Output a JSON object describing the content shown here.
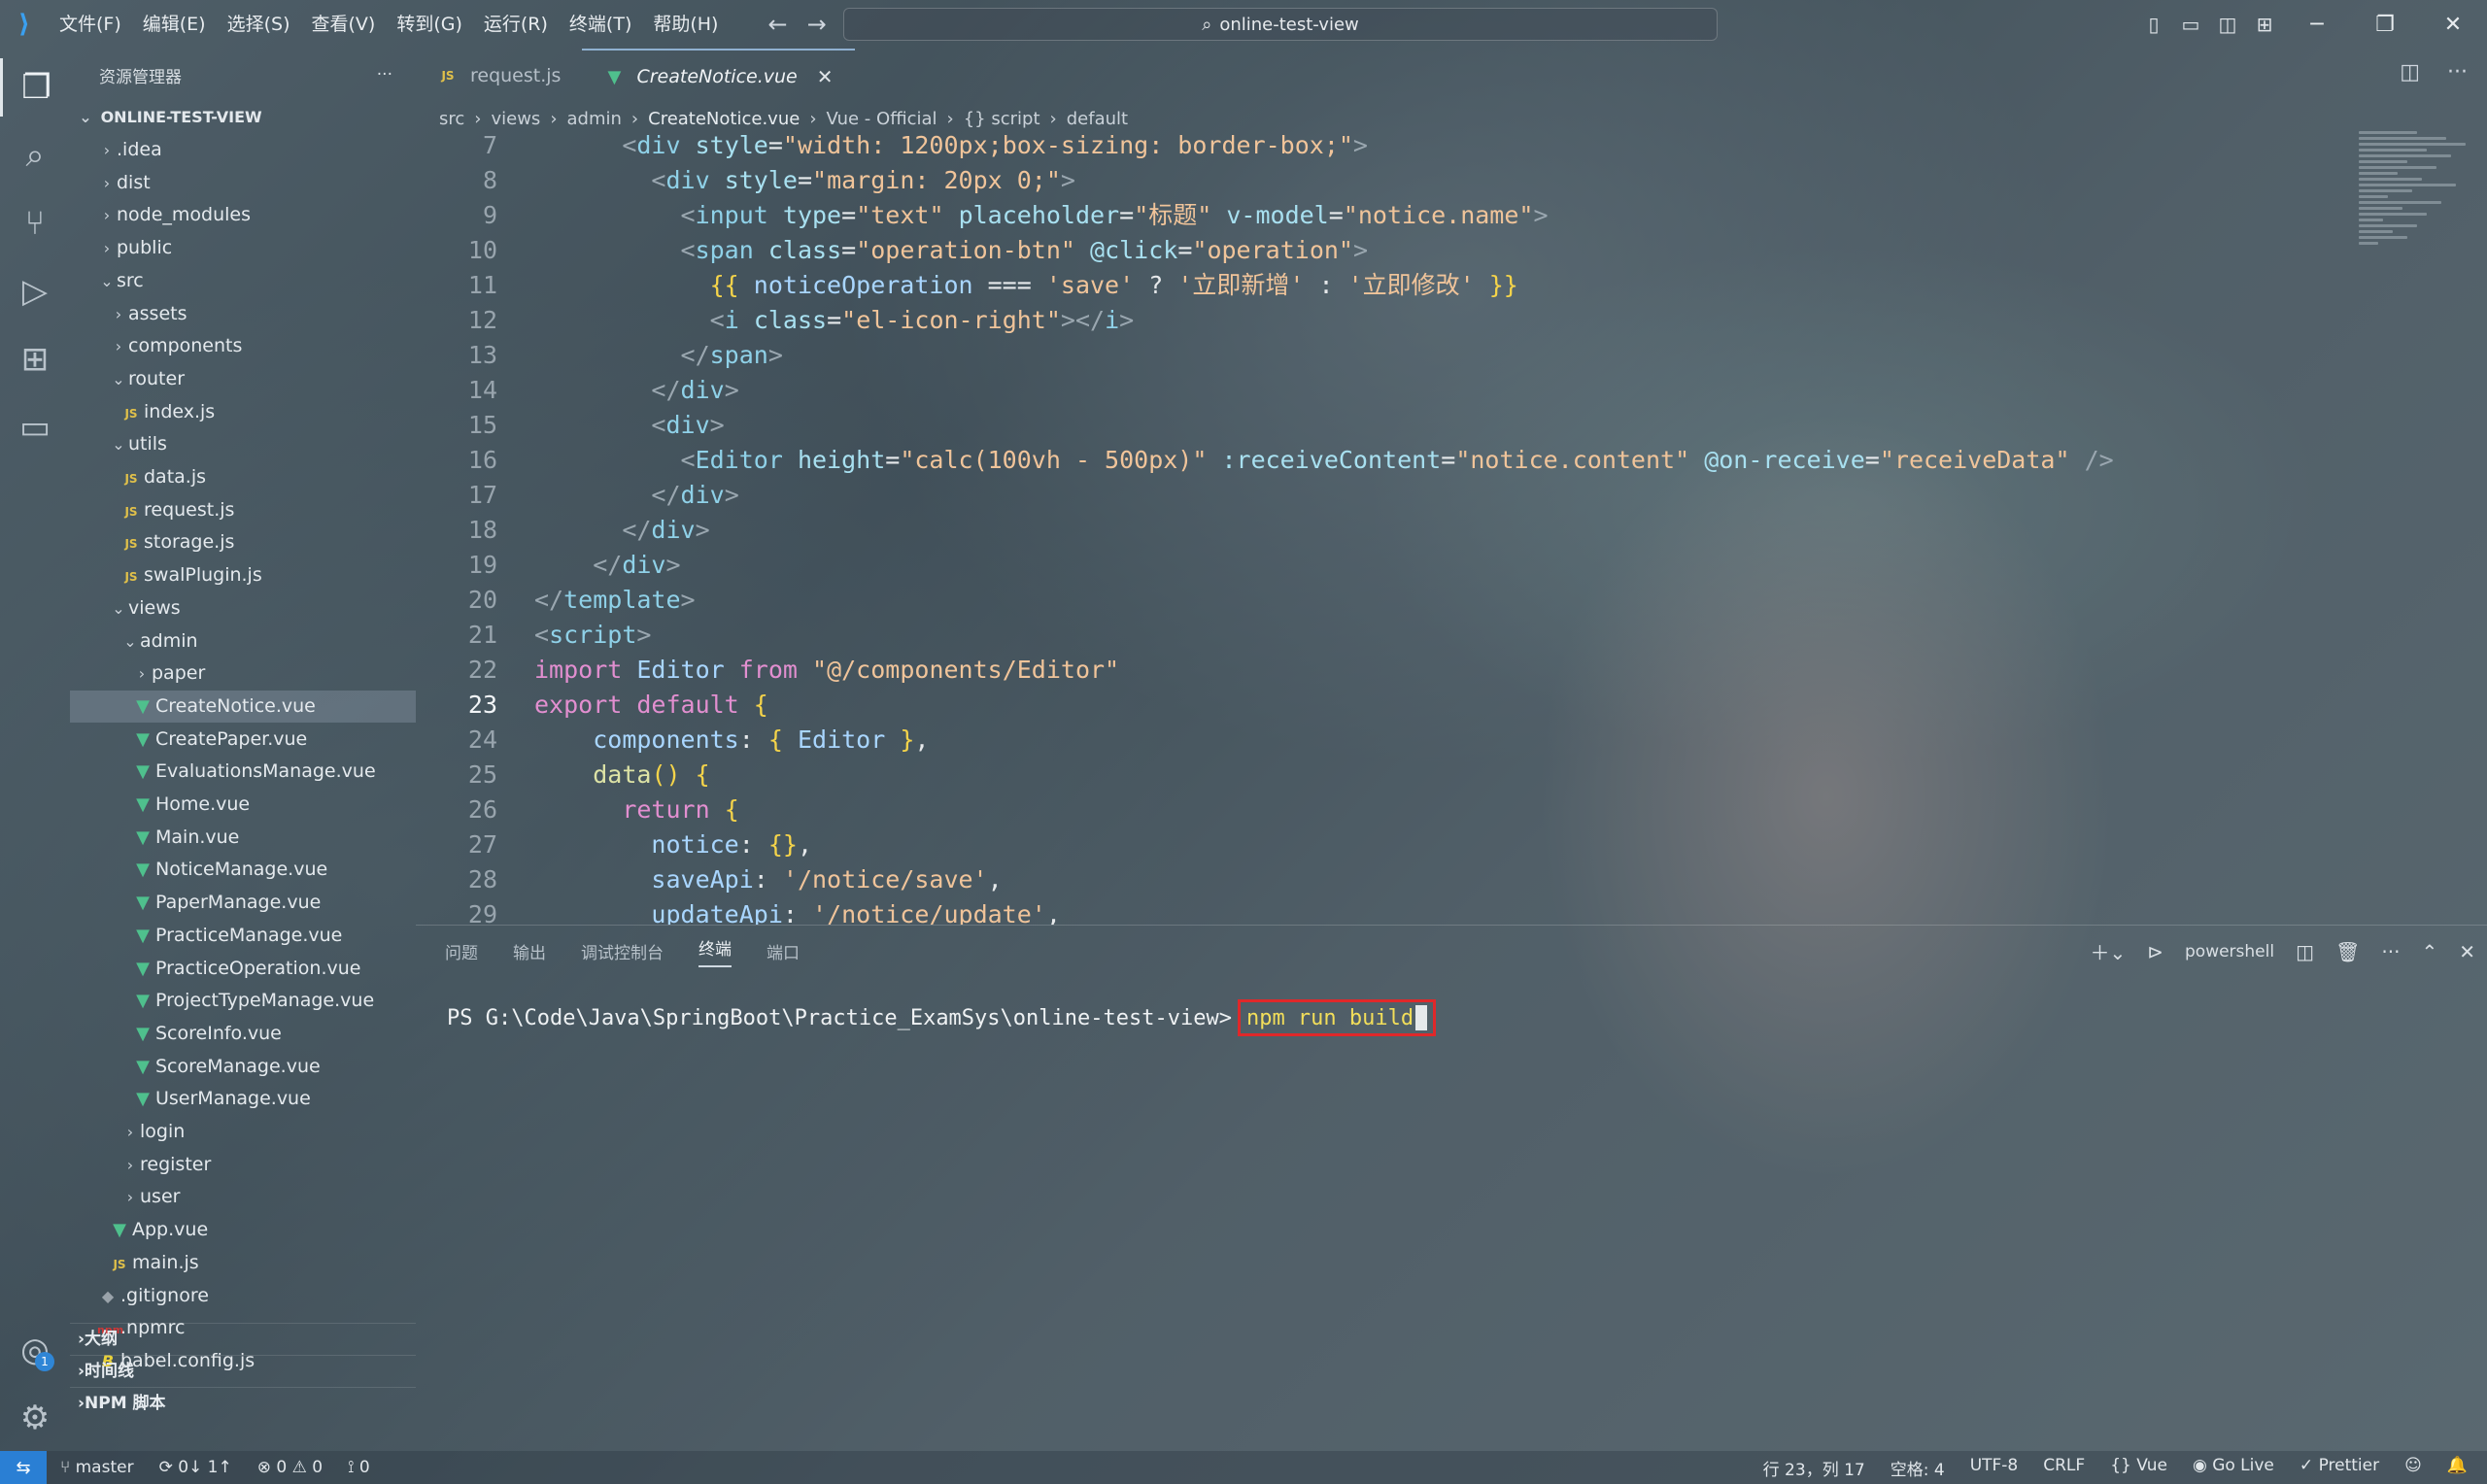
{
  "titlebar": {
    "menu": [
      "文件(F)",
      "编辑(E)",
      "选择(S)",
      "查看(V)",
      "转到(G)",
      "运行(R)",
      "终端(T)",
      "帮助(H)"
    ],
    "search_text": "online-test-view"
  },
  "sidebar": {
    "title": "资源管理器",
    "root": "ONLINE-TEST-VIEW",
    "items": [
      {
        "label": ".idea",
        "type": "folder",
        "depth": 0,
        "open": false
      },
      {
        "label": "dist",
        "type": "folder",
        "depth": 0,
        "open": false
      },
      {
        "label": "node_modules",
        "type": "folder",
        "depth": 0,
        "open": false
      },
      {
        "label": "public",
        "type": "folder",
        "depth": 0,
        "open": false
      },
      {
        "label": "src",
        "type": "folder",
        "depth": 0,
        "open": true
      },
      {
        "label": "assets",
        "type": "folder",
        "depth": 1,
        "open": false
      },
      {
        "label": "components",
        "type": "folder",
        "depth": 1,
        "open": false
      },
      {
        "label": "router",
        "type": "folder",
        "depth": 1,
        "open": true
      },
      {
        "label": "index.js",
        "type": "js",
        "depth": 2
      },
      {
        "label": "utils",
        "type": "folder",
        "depth": 1,
        "open": true
      },
      {
        "label": "data.js",
        "type": "js",
        "depth": 2
      },
      {
        "label": "request.js",
        "type": "js",
        "depth": 2
      },
      {
        "label": "storage.js",
        "type": "js",
        "depth": 2
      },
      {
        "label": "swalPlugin.js",
        "type": "js",
        "depth": 2
      },
      {
        "label": "views",
        "type": "folder",
        "depth": 1,
        "open": true
      },
      {
        "label": "admin",
        "type": "folder",
        "depth": 2,
        "open": true
      },
      {
        "label": "paper",
        "type": "folder",
        "depth": 3,
        "open": false
      },
      {
        "label": "CreateNotice.vue",
        "type": "vue",
        "depth": 3,
        "selected": true
      },
      {
        "label": "CreatePaper.vue",
        "type": "vue",
        "depth": 3
      },
      {
        "label": "EvaluationsManage.vue",
        "type": "vue",
        "depth": 3
      },
      {
        "label": "Home.vue",
        "type": "vue",
        "depth": 3
      },
      {
        "label": "Main.vue",
        "type": "vue",
        "depth": 3
      },
      {
        "label": "NoticeManage.vue",
        "type": "vue",
        "depth": 3
      },
      {
        "label": "PaperManage.vue",
        "type": "vue",
        "depth": 3
      },
      {
        "label": "PracticeManage.vue",
        "type": "vue",
        "depth": 3
      },
      {
        "label": "PracticeOperation.vue",
        "type": "vue",
        "depth": 3
      },
      {
        "label": "ProjectTypeManage.vue",
        "type": "vue",
        "depth": 3
      },
      {
        "label": "ScoreInfo.vue",
        "type": "vue",
        "depth": 3
      },
      {
        "label": "ScoreManage.vue",
        "type": "vue",
        "depth": 3
      },
      {
        "label": "UserManage.vue",
        "type": "vue",
        "depth": 3
      },
      {
        "label": "login",
        "type": "folder",
        "depth": 2,
        "open": false
      },
      {
        "label": "register",
        "type": "folder",
        "depth": 2,
        "open": false
      },
      {
        "label": "user",
        "type": "folder",
        "depth": 2,
        "open": false
      },
      {
        "label": "App.vue",
        "type": "vue",
        "depth": 1
      },
      {
        "label": "main.js",
        "type": "js",
        "depth": 1
      },
      {
        "label": ".gitignore",
        "type": "git",
        "depth": 0
      },
      {
        "label": ".npmrc",
        "type": "npm",
        "depth": 0
      },
      {
        "label": "babel.config.js",
        "type": "babel",
        "depth": 0
      }
    ],
    "sections": [
      "大纲",
      "时间线",
      "NPM 脚本"
    ]
  },
  "tabs": [
    {
      "label": "request.js",
      "icon": "JS",
      "active": false
    },
    {
      "label": "CreateNotice.vue",
      "icon": "vue",
      "active": true
    }
  ],
  "breadcrumb": [
    "src",
    "views",
    "admin",
    "CreateNotice.vue",
    "Vue - Official",
    "{} script",
    "default"
  ],
  "code": {
    "current_line": 23,
    "lines": [
      {
        "n": "7",
        "tokens": [
          [
            "ind",
            "      "
          ],
          [
            "t-punct",
            "<"
          ],
          [
            "t-tag",
            "div"
          ],
          [
            "txt",
            " "
          ],
          [
            "t-attr",
            "style"
          ],
          [
            "txt",
            "="
          ],
          [
            "t-str",
            "\"width: 1200px;box-sizing: border-box;\""
          ],
          [
            "t-punct",
            ">"
          ]
        ]
      },
      {
        "n": "8",
        "tokens": [
          [
            "ind",
            "        "
          ],
          [
            "t-punct",
            "<"
          ],
          [
            "t-tag",
            "div"
          ],
          [
            "txt",
            " "
          ],
          [
            "t-attr",
            "style"
          ],
          [
            "txt",
            "="
          ],
          [
            "t-str",
            "\"margin: 20px 0;\""
          ],
          [
            "t-punct",
            ">"
          ]
        ]
      },
      {
        "n": "9",
        "tokens": [
          [
            "ind",
            "          "
          ],
          [
            "t-punct",
            "<"
          ],
          [
            "t-tag",
            "input"
          ],
          [
            "txt",
            " "
          ],
          [
            "t-attr",
            "type"
          ],
          [
            "txt",
            "="
          ],
          [
            "t-str",
            "\"text\""
          ],
          [
            "txt",
            " "
          ],
          [
            "t-attr",
            "placeholder"
          ],
          [
            "txt",
            "="
          ],
          [
            "t-str",
            "\"标题\""
          ],
          [
            "txt",
            " "
          ],
          [
            "t-attr",
            "v-model"
          ],
          [
            "txt",
            "="
          ],
          [
            "t-str",
            "\"notice.name\""
          ],
          [
            "t-punct",
            ">"
          ]
        ]
      },
      {
        "n": "10",
        "tokens": [
          [
            "ind",
            "          "
          ],
          [
            "t-punct",
            "<"
          ],
          [
            "t-tag",
            "span"
          ],
          [
            "txt",
            " "
          ],
          [
            "t-attr",
            "class"
          ],
          [
            "txt",
            "="
          ],
          [
            "t-str",
            "\"operation-btn\""
          ],
          [
            "txt",
            " "
          ],
          [
            "t-attr",
            "@click"
          ],
          [
            "txt",
            "="
          ],
          [
            "t-str",
            "\"operation\""
          ],
          [
            "t-punct",
            ">"
          ]
        ]
      },
      {
        "n": "11",
        "tokens": [
          [
            "ind",
            "            "
          ],
          [
            "t-brace",
            "{{"
          ],
          [
            "txt",
            " "
          ],
          [
            "t-var",
            "noticeOperation"
          ],
          [
            "txt",
            " === "
          ],
          [
            "t-str",
            "'save'"
          ],
          [
            "txt",
            " ? "
          ],
          [
            "t-str",
            "'立即新增'"
          ],
          [
            "txt",
            " : "
          ],
          [
            "t-str",
            "'立即修改'"
          ],
          [
            "txt",
            " "
          ],
          [
            "t-brace",
            "}}"
          ]
        ]
      },
      {
        "n": "12",
        "tokens": [
          [
            "ind",
            "            "
          ],
          [
            "t-punct",
            "<"
          ],
          [
            "t-tag",
            "i"
          ],
          [
            "txt",
            " "
          ],
          [
            "t-attr",
            "class"
          ],
          [
            "txt",
            "="
          ],
          [
            "t-str",
            "\"el-icon-right\""
          ],
          [
            "t-punct",
            "></"
          ],
          [
            "t-tag",
            "i"
          ],
          [
            "t-punct",
            ">"
          ]
        ]
      },
      {
        "n": "13",
        "tokens": [
          [
            "ind",
            "          "
          ],
          [
            "t-punct",
            "</"
          ],
          [
            "t-tag",
            "span"
          ],
          [
            "t-punct",
            ">"
          ]
        ]
      },
      {
        "n": "14",
        "tokens": [
          [
            "ind",
            "        "
          ],
          [
            "t-punct",
            "</"
          ],
          [
            "t-tag",
            "div"
          ],
          [
            "t-punct",
            ">"
          ]
        ]
      },
      {
        "n": "15",
        "tokens": [
          [
            "ind",
            "        "
          ],
          [
            "t-punct",
            "<"
          ],
          [
            "t-tag",
            "div"
          ],
          [
            "t-punct",
            ">"
          ]
        ]
      },
      {
        "n": "16",
        "tokens": [
          [
            "ind",
            "          "
          ],
          [
            "t-punct",
            "<"
          ],
          [
            "t-tag",
            "Editor"
          ],
          [
            "txt",
            " "
          ],
          [
            "t-attr",
            "height"
          ],
          [
            "txt",
            "="
          ],
          [
            "t-str",
            "\"calc(100vh - 500px)\""
          ],
          [
            "txt",
            " "
          ],
          [
            "t-attr",
            ":receiveContent"
          ],
          [
            "txt",
            "="
          ],
          [
            "t-str",
            "\"notice.content\""
          ],
          [
            "txt",
            " "
          ],
          [
            "t-attr",
            "@on-receive"
          ],
          [
            "txt",
            "="
          ],
          [
            "t-str",
            "\"receiveData\""
          ],
          [
            "txt",
            " "
          ],
          [
            "t-punct",
            "/>"
          ]
        ]
      },
      {
        "n": "17",
        "tokens": [
          [
            "ind",
            "        "
          ],
          [
            "t-punct",
            "</"
          ],
          [
            "t-tag",
            "div"
          ],
          [
            "t-punct",
            ">"
          ]
        ]
      },
      {
        "n": "18",
        "tokens": [
          [
            "ind",
            "      "
          ],
          [
            "t-punct",
            "</"
          ],
          [
            "t-tag",
            "div"
          ],
          [
            "t-punct",
            ">"
          ]
        ]
      },
      {
        "n": "19",
        "tokens": [
          [
            "ind",
            "    "
          ],
          [
            "t-punct",
            "</"
          ],
          [
            "t-tag",
            "div"
          ],
          [
            "t-punct",
            ">"
          ]
        ]
      },
      {
        "n": "20",
        "tokens": [
          [
            "ind",
            ""
          ],
          [
            "t-punct",
            "</"
          ],
          [
            "t-tag",
            "template"
          ],
          [
            "t-punct",
            ">"
          ]
        ]
      },
      {
        "n": "21",
        "tokens": [
          [
            "ind",
            ""
          ],
          [
            "t-punct",
            "<"
          ],
          [
            "t-tag",
            "script"
          ],
          [
            "t-punct",
            ">"
          ]
        ]
      },
      {
        "n": "22",
        "tokens": [
          [
            "ind",
            ""
          ],
          [
            "t-kw",
            "import"
          ],
          [
            "txt",
            " "
          ],
          [
            "t-var",
            "Editor"
          ],
          [
            "txt",
            " "
          ],
          [
            "t-kw",
            "from"
          ],
          [
            "txt",
            " "
          ],
          [
            "t-str",
            "\"@/components/Editor\""
          ]
        ]
      },
      {
        "n": "23",
        "tokens": [
          [
            "ind",
            ""
          ],
          [
            "t-kw",
            "export default"
          ],
          [
            "txt",
            " "
          ],
          [
            "t-brace",
            "{"
          ]
        ]
      },
      {
        "n": "24",
        "tokens": [
          [
            "ind",
            "    "
          ],
          [
            "t-var",
            "components"
          ],
          [
            "txt",
            ": "
          ],
          [
            "t-brace",
            "{"
          ],
          [
            "txt",
            " "
          ],
          [
            "t-var",
            "Editor"
          ],
          [
            "txt",
            " "
          ],
          [
            "t-brace",
            "}"
          ],
          [
            "txt",
            ","
          ]
        ]
      },
      {
        "n": "25",
        "tokens": [
          [
            "ind",
            "    "
          ],
          [
            "t-fn",
            "data"
          ],
          [
            "t-brace",
            "()"
          ],
          [
            "txt",
            " "
          ],
          [
            "t-brace",
            "{"
          ]
        ]
      },
      {
        "n": "26",
        "tokens": [
          [
            "ind",
            "      "
          ],
          [
            "t-kw",
            "return"
          ],
          [
            "txt",
            " "
          ],
          [
            "t-brace",
            "{"
          ]
        ]
      },
      {
        "n": "27",
        "tokens": [
          [
            "ind",
            "        "
          ],
          [
            "t-var",
            "notice"
          ],
          [
            "txt",
            ": "
          ],
          [
            "t-brace",
            "{}"
          ],
          [
            "txt",
            ","
          ]
        ]
      },
      {
        "n": "28",
        "tokens": [
          [
            "ind",
            "        "
          ],
          [
            "t-var",
            "saveApi"
          ],
          [
            "txt",
            ": "
          ],
          [
            "t-str",
            "'/notice/save'"
          ],
          [
            "txt",
            ","
          ]
        ]
      },
      {
        "n": "29",
        "tokens": [
          [
            "ind",
            "        "
          ],
          [
            "t-var",
            "updateApi"
          ],
          [
            "txt",
            ": "
          ],
          [
            "t-str",
            "'/notice/update'"
          ],
          [
            "txt",
            ","
          ]
        ]
      }
    ]
  },
  "panel": {
    "tabs": [
      "问题",
      "输出",
      "调试控制台",
      "终端",
      "端口"
    ],
    "active_tab": "终端",
    "shell": "powershell",
    "prompt": "PS G:\\Code\\Java\\SpringBoot\\Practice_ExamSys\\online-test-view>",
    "command": "npm run build"
  },
  "statusbar": {
    "branch": "master",
    "sync": "0↓ 1↑",
    "errors": "0",
    "warnings": "0",
    "ports": "0",
    "position": "行 23，列 17",
    "spaces": "空格: 4",
    "encoding": "UTF-8",
    "eol": "CRLF",
    "language": "Vue",
    "golive": "Go Live",
    "prettier": "Prettier"
  },
  "accounts_badge": "1"
}
